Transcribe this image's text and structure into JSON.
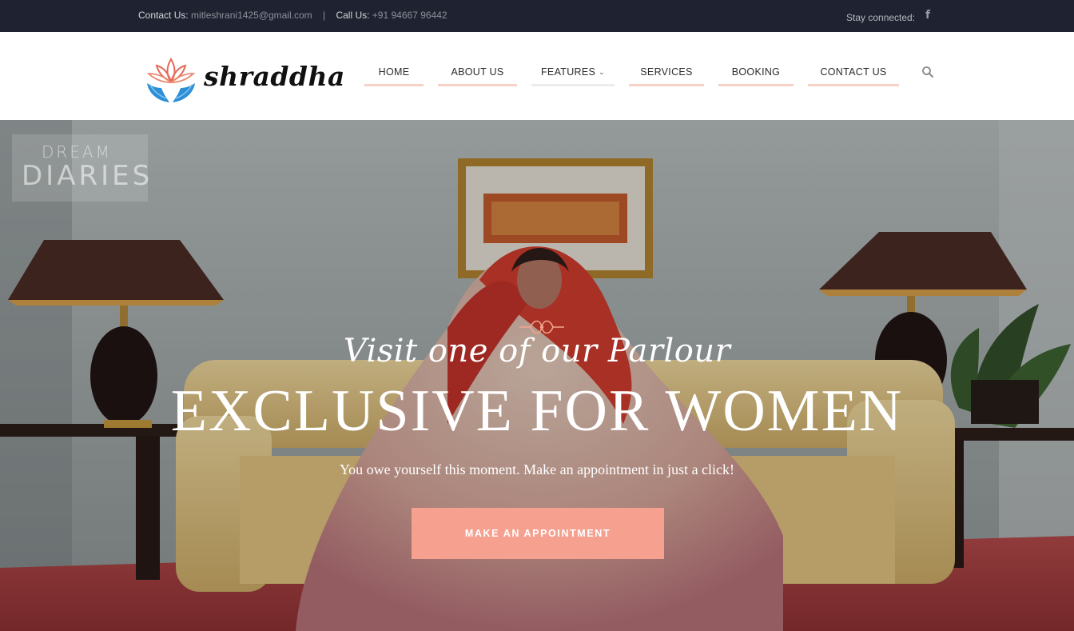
{
  "topbar": {
    "contact_label": "Contact Us:",
    "contact_email": "mitleshrani1425@gmail.com",
    "separator": "|",
    "call_label": "Call Us:",
    "call_number": "+91 94667 96442",
    "stay_connected": "Stay connected:",
    "social_icon": "facebook-icon",
    "social_glyph": "f"
  },
  "header": {
    "logo_text": "shraddha",
    "logo_icon": "lotus-hands-icon",
    "nav": [
      {
        "label": "HOME"
      },
      {
        "label": "ABOUT US"
      },
      {
        "label": "FEATURES",
        "has_dropdown": true
      },
      {
        "label": "SERVICES"
      },
      {
        "label": "BOOKING"
      },
      {
        "label": "CONTACT US"
      }
    ],
    "search_icon": "search-icon",
    "accent_color": "#f4d2c7"
  },
  "hero": {
    "watermark_line1": "DREAM",
    "watermark_line2": "DIARIES",
    "script_title": "Visit one of our Parlour",
    "headline": "EXCLUSIVE FOR WOMEN",
    "tagline": "You owe yourself this moment. Make an appointment in just a click!",
    "cta_label": "MAKE AN APPOINTMENT",
    "cta_color": "#f6a190"
  }
}
